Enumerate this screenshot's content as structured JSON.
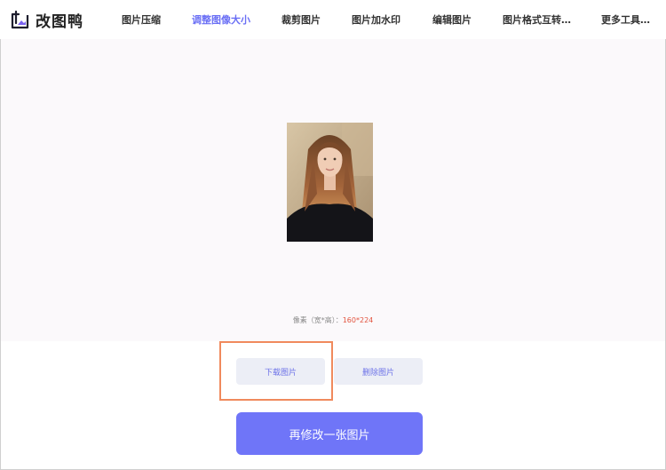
{
  "brand": {
    "name": "改图鸭",
    "accent": "#6f75f8"
  },
  "nav": {
    "items": [
      {
        "label": "图片压缩",
        "active": false
      },
      {
        "label": "调整图像大小",
        "active": true
      },
      {
        "label": "裁剪图片",
        "active": false
      },
      {
        "label": "图片加水印",
        "active": false
      },
      {
        "label": "编辑图片",
        "active": false
      },
      {
        "label": "图片格式互转…",
        "active": false
      },
      {
        "label": "更多工具…",
        "active": false
      }
    ]
  },
  "preview": {
    "dims_label": "像素（宽*高）：",
    "dims_value": "160*224"
  },
  "actions": {
    "download_label": "下载图片",
    "delete_label": "删除图片",
    "modify_another_label": "再修改一张图片"
  },
  "colors": {
    "highlight_border": "#f08a5d",
    "dims_value": "#e2543f",
    "nav_active": "#6a6ff5"
  }
}
